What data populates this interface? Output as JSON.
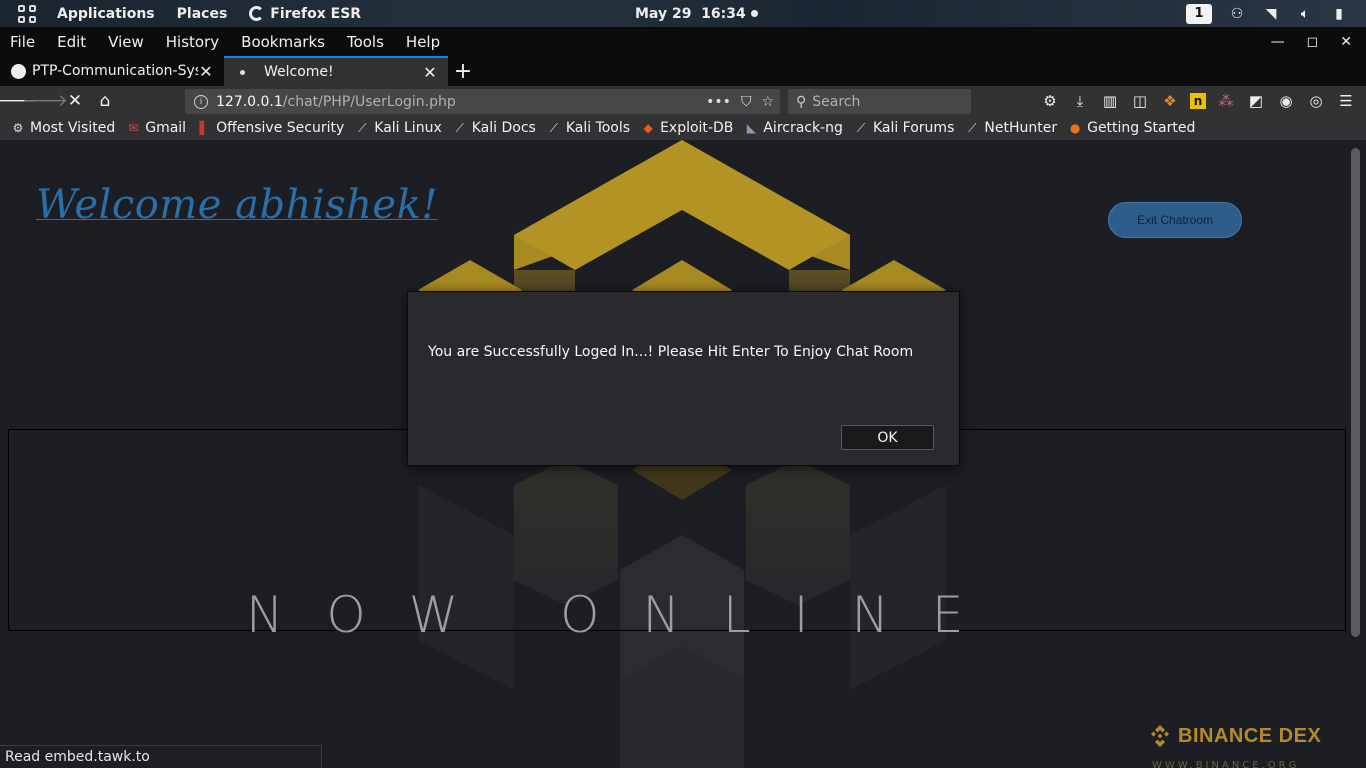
{
  "system": {
    "activities_label": "Applications",
    "places_label": "Places",
    "app_label": "Firefox ESR",
    "clock": "May 29  16:34",
    "workspace": "1"
  },
  "menubar": {
    "file": "File",
    "edit": "Edit",
    "view": "View",
    "history": "History",
    "bookmarks": "Bookmarks",
    "tools": "Tools",
    "help": "Help"
  },
  "tabs": [
    {
      "title": "PTP-Communication-Sys",
      "favicon": "github-icon"
    },
    {
      "title": "Welcome!",
      "favicon": "loading-dot"
    }
  ],
  "urlbar": {
    "host": "127.0.0.1",
    "path": "/chat/PHP/UserLogin.php"
  },
  "search": {
    "placeholder": "Search"
  },
  "bookmarks": [
    {
      "label": "Most Visited",
      "icon": "gear-icon"
    },
    {
      "label": "Gmail",
      "icon": "gmail-icon"
    },
    {
      "label": "Offensive Security",
      "icon": "offsec-icon"
    },
    {
      "label": "Kali Linux",
      "icon": "kali-icon"
    },
    {
      "label": "Kali Docs",
      "icon": "kali-icon"
    },
    {
      "label": "Kali Tools",
      "icon": "kali-icon"
    },
    {
      "label": "Exploit-DB",
      "icon": "exploitdb-icon"
    },
    {
      "label": "Aircrack-ng",
      "icon": "aircrack-icon"
    },
    {
      "label": "Kali Forums",
      "icon": "kali-icon"
    },
    {
      "label": "NetHunter",
      "icon": "kali-icon"
    },
    {
      "label": "Getting Started",
      "icon": "firefox-icon"
    }
  ],
  "page": {
    "welcome": "Welcome abhishek!",
    "exit_button": "Exit Chatroom",
    "now_online": "NOW ONLINE",
    "brand": "BINANCE DEX",
    "brand_sub": "WWW.BINANCE.ORG"
  },
  "dialog": {
    "message": "You are Successfully Loged In...! Please Hit Enter To Enjoy Chat Room",
    "ok": "OK"
  },
  "status": {
    "text": "Read embed.tawk.to"
  },
  "colors": {
    "accent": "#0a84ff",
    "logo_gold": "#b8962a"
  }
}
